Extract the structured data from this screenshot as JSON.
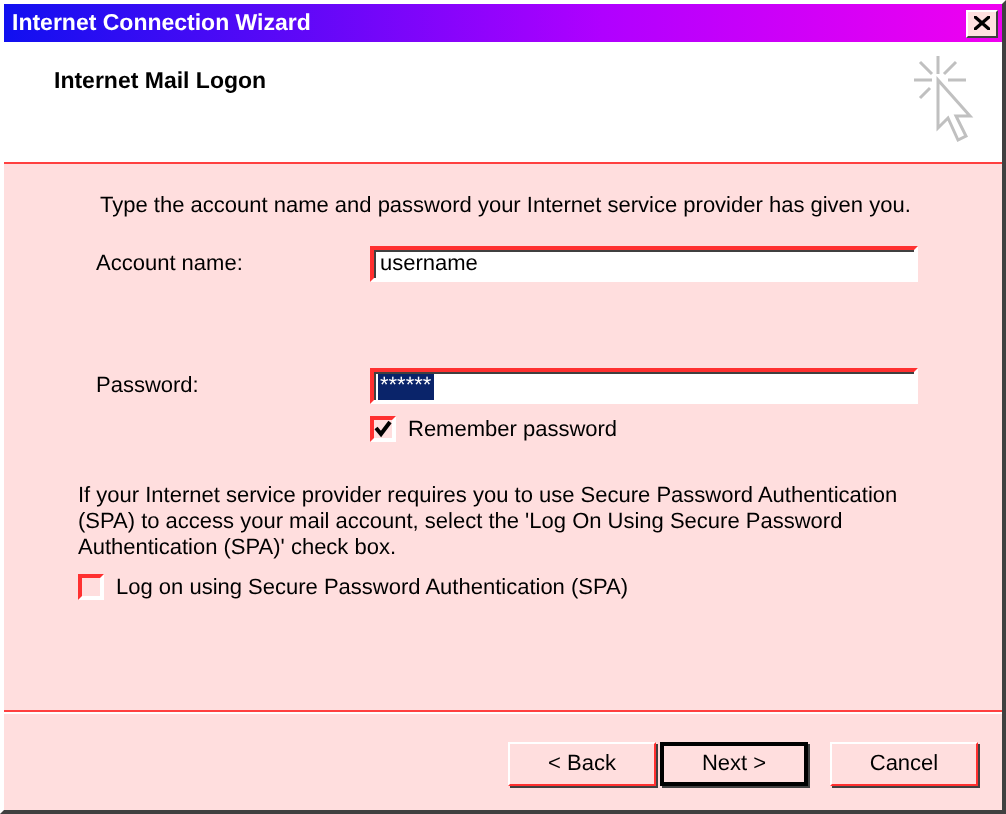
{
  "window": {
    "title": "Internet Connection Wizard"
  },
  "header": {
    "title": "Internet Mail Logon"
  },
  "intro": "Type the account name and password your Internet service provider has given you.",
  "fields": [
    {
      "label": "Account name:",
      "value": "username",
      "selected": false
    },
    {
      "label": "Password:",
      "value": "******",
      "selected": true
    }
  ],
  "remember": {
    "label": "Remember password",
    "checked": true
  },
  "spa_note": "If your Internet service provider requires you to use Secure Password Authentication (SPA) to access your mail account, select the 'Log On Using Secure Password Authentication (SPA)' check box.",
  "spa": {
    "label": "Log on using Secure Password Authentication (SPA)",
    "checked": false
  },
  "buttons": [
    {
      "label": "< Back",
      "default": false
    },
    {
      "label": "Next >",
      "default": true
    },
    {
      "label": "Cancel",
      "default": false
    }
  ]
}
